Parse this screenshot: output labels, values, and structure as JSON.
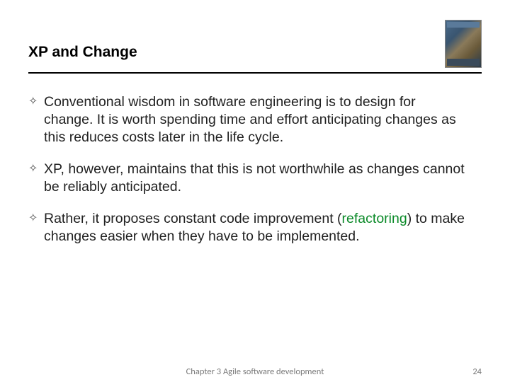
{
  "slide": {
    "title": "XP and Change",
    "bullets": [
      {
        "text": "Conventional wisdom in software engineering is to design for change. It is worth spending time and effort anticipating changes as this reduces costs later in the life cycle."
      },
      {
        "text": "XP, however, maintains that this is not worthwhile as changes cannot be reliably anticipated."
      },
      {
        "pre": "Rather, it proposes constant code improvement (",
        "highlight": "refactoring",
        "post": ") to make changes easier when they have to be implemented."
      }
    ],
    "footer": {
      "center": "Chapter 3 Agile software development",
      "page": "24"
    },
    "book_image_alt": "Software Engineering textbook cover"
  }
}
